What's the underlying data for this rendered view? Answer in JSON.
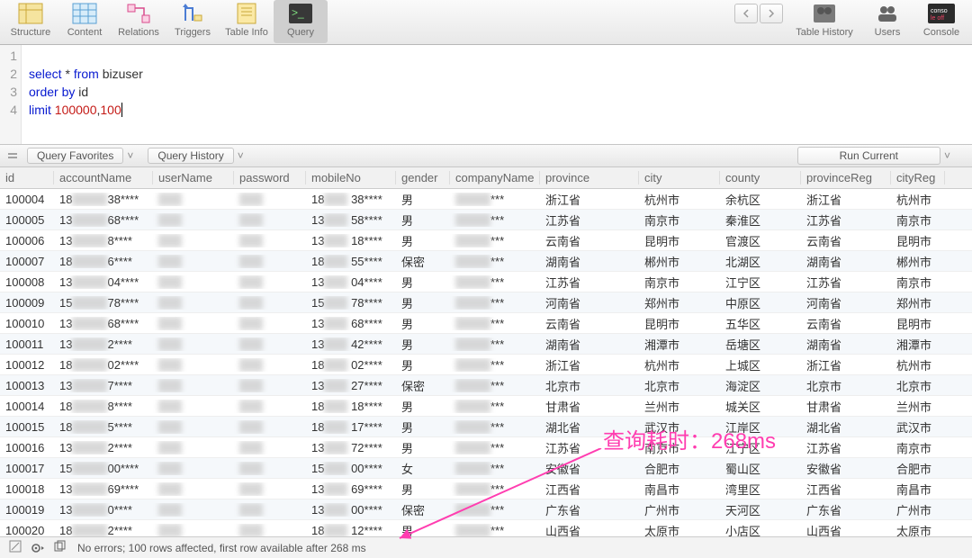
{
  "toolbar": {
    "items": [
      "Structure",
      "Content",
      "Relations",
      "Triggers",
      "Table Info",
      "Query"
    ],
    "active_index": 5,
    "right": [
      "Table History",
      "Users",
      "Console"
    ]
  },
  "editor": {
    "lines_count": 4,
    "tokens": [
      [],
      [
        {
          "t": "select",
          "c": "kw"
        },
        {
          "t": " * "
        },
        {
          "t": "from",
          "c": "kw"
        },
        {
          "t": " bizuser"
        }
      ],
      [
        {
          "t": "order by",
          "c": "kw"
        },
        {
          "t": " id"
        }
      ],
      [
        {
          "t": "limit",
          "c": "kw"
        },
        {
          "t": " "
        },
        {
          "t": "100000",
          "c": "num"
        },
        {
          "t": ","
        },
        {
          "t": "100",
          "c": "num"
        }
      ]
    ]
  },
  "midbar": {
    "fav_label": "Query Favorites",
    "hist_label": "Query History",
    "run_label": "Run Current"
  },
  "columns": [
    "id",
    "accountName",
    "userName",
    "password",
    "mobileNo",
    "gender",
    "companyName",
    "province",
    "city",
    "county",
    "provinceReg",
    "cityReg"
  ],
  "rows": [
    {
      "id": "100004",
      "acc": "18███38****",
      "mob": "18██ 38****",
      "gender": "男",
      "prov": "浙江省",
      "city": "杭州市",
      "county": "余杭区",
      "preg": "浙江省",
      "creg": "杭州市"
    },
    {
      "id": "100005",
      "acc": "13███68****",
      "mob": "13██ 58****",
      "gender": "男",
      "prov": "江苏省",
      "city": "南京市",
      "county": "秦淮区",
      "preg": "江苏省",
      "creg": "南京市"
    },
    {
      "id": "100006",
      "acc": "13███8****",
      "mob": "13██ 18****",
      "gender": "男",
      "prov": "云南省",
      "city": "昆明市",
      "county": "官渡区",
      "preg": "云南省",
      "creg": "昆明市"
    },
    {
      "id": "100007",
      "acc": "18███6****",
      "mob": "18██ 55****",
      "gender": "保密",
      "prov": "湖南省",
      "city": "郴州市",
      "county": "北湖区",
      "preg": "湖南省",
      "creg": "郴州市"
    },
    {
      "id": "100008",
      "acc": "13███04****",
      "mob": "13██ 04****",
      "gender": "男",
      "prov": "江苏省",
      "city": "南京市",
      "county": "江宁区",
      "preg": "江苏省",
      "creg": "南京市"
    },
    {
      "id": "100009",
      "acc": "15███78****",
      "mob": "15██ 78****",
      "gender": "男",
      "prov": "河南省",
      "city": "郑州市",
      "county": "中原区",
      "preg": "河南省",
      "creg": "郑州市"
    },
    {
      "id": "100010",
      "acc": "13███68****",
      "mob": "13██ 68****",
      "gender": "男",
      "prov": "云南省",
      "city": "昆明市",
      "county": "五华区",
      "preg": "云南省",
      "creg": "昆明市"
    },
    {
      "id": "100011",
      "acc": "13███2****",
      "mob": "13██ 42****",
      "gender": "男",
      "prov": "湖南省",
      "city": "湘潭市",
      "county": "岳塘区",
      "preg": "湖南省",
      "creg": "湘潭市"
    },
    {
      "id": "100012",
      "acc": "18███02****",
      "mob": "18██ 02****",
      "gender": "男",
      "prov": "浙江省",
      "city": "杭州市",
      "county": "上城区",
      "preg": "浙江省",
      "creg": "杭州市"
    },
    {
      "id": "100013",
      "acc": "13███7****",
      "mob": "13██ 27****",
      "gender": "保密",
      "prov": "北京市",
      "city": "北京市",
      "county": "海淀区",
      "preg": "北京市",
      "creg": "北京市"
    },
    {
      "id": "100014",
      "acc": "18███8****",
      "mob": "18██ 18****",
      "gender": "男",
      "prov": "甘肃省",
      "city": "兰州市",
      "county": "城关区",
      "preg": "甘肃省",
      "creg": "兰州市"
    },
    {
      "id": "100015",
      "acc": "18███5****",
      "mob": "18██ 17****",
      "gender": "男",
      "prov": "湖北省",
      "city": "武汉市",
      "county": "江岸区",
      "preg": "湖北省",
      "creg": "武汉市"
    },
    {
      "id": "100016",
      "acc": "13███2****",
      "mob": "13██ 72****",
      "gender": "男",
      "prov": "江苏省",
      "city": "南京市",
      "county": "江宁区",
      "preg": "江苏省",
      "creg": "南京市"
    },
    {
      "id": "100017",
      "acc": "15███00****",
      "mob": "15██ 00****",
      "gender": "女",
      "prov": "安徽省",
      "city": "合肥市",
      "county": "蜀山区",
      "preg": "安徽省",
      "creg": "合肥市"
    },
    {
      "id": "100018",
      "acc": "13███69****",
      "mob": "13██ 69****",
      "gender": "男",
      "prov": "江西省",
      "city": "南昌市",
      "county": "湾里区",
      "preg": "江西省",
      "creg": "南昌市"
    },
    {
      "id": "100019",
      "acc": "13███0****",
      "mob": "13██ 00****",
      "gender": "保密",
      "prov": "广东省",
      "city": "广州市",
      "county": "天河区",
      "preg": "广东省",
      "creg": "广州市"
    },
    {
      "id": "100020",
      "acc": "18███2****",
      "mob": "18██ 12****",
      "gender": "男",
      "prov": "山西省",
      "city": "太原市",
      "county": "小店区",
      "preg": "山西省",
      "creg": "太原市"
    }
  ],
  "status_text": "No errors; 100 rows affected, first row available after 268 ms",
  "annotation": "查询耗时：268ms"
}
